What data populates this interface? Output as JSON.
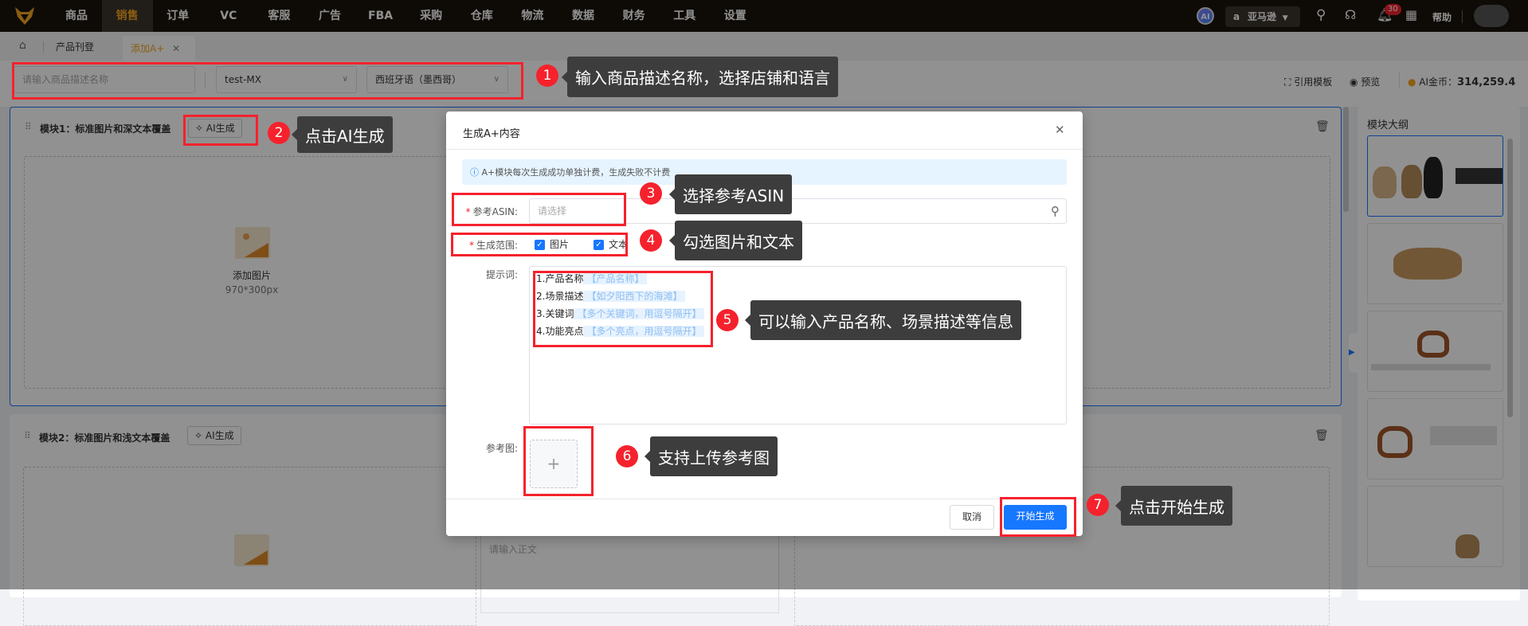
{
  "nav": {
    "items": [
      "商品",
      "销售",
      "订单",
      "VC",
      "客服",
      "广告",
      "FBA",
      "采购",
      "仓库",
      "物流",
      "数据",
      "财务",
      "工具",
      "设置"
    ],
    "active_index": 1,
    "ai_badge": "AI",
    "marketplace": "亚马逊",
    "notification_count": "30",
    "help": "帮助"
  },
  "tabs": {
    "items": [
      {
        "label": "产品刊登"
      },
      {
        "label": "添加A+",
        "active": true
      }
    ]
  },
  "toolbar": {
    "name_placeholder": "请输入商品描述名称",
    "store": "test-MX",
    "language": "西班牙语（墨西哥）",
    "template": "引用模板",
    "preview": "预览",
    "coins_label": "AI金币：",
    "coins_value": "314,259.4"
  },
  "modules": [
    {
      "title": "模块1：标准图片和深文本覆盖",
      "ai_label": "AI生成",
      "add_image": "添加图片",
      "size": "970*300px"
    },
    {
      "title": "模块2：标准图片和浅文本覆盖",
      "ai_label": "AI生成",
      "body_placeholder": "请输入正文"
    }
  ],
  "outline": {
    "title": "模块大纲"
  },
  "modal": {
    "title": "生成A+内容",
    "notice": "A+模块每次生成成功单独计费，生成失败不计费",
    "asin_label": "参考ASIN:",
    "asin_placeholder": "请选择",
    "range_label": "生成范围:",
    "range_options": [
      {
        "label": "图片",
        "checked": true
      },
      {
        "label": "文本",
        "checked": true
      }
    ],
    "prompt_label": "提示词:",
    "prompt_lines": [
      {
        "key": "1.产品名称",
        "hint": "【产品名称】"
      },
      {
        "key": "2.场景描述",
        "hint": "【如夕阳西下的海滩】"
      },
      {
        "key": "3.关键词",
        "hint": "【多个关键词，用逗号隔开】"
      },
      {
        "key": "4.功能亮点",
        "hint": "【多个亮点，用逗号隔开】"
      }
    ],
    "ref_label": "参考图:",
    "cancel": "取消",
    "start": "开始生成"
  },
  "callouts": [
    {
      "n": "1",
      "text": "输入商品描述名称，选择店铺和语言"
    },
    {
      "n": "2",
      "text": "点击AI生成"
    },
    {
      "n": "3",
      "text": "选择参考ASIN"
    },
    {
      "n": "4",
      "text": "勾选图片和文本"
    },
    {
      "n": "5",
      "text": "可以输入产品名称、场景描述等信息"
    },
    {
      "n": "6",
      "text": "支持上传参考图"
    },
    {
      "n": "7",
      "text": "点击开始生成"
    }
  ],
  "colors": {
    "primary": "#1677ff",
    "accent": "#f5a623",
    "annotation": "#f5222d"
  }
}
